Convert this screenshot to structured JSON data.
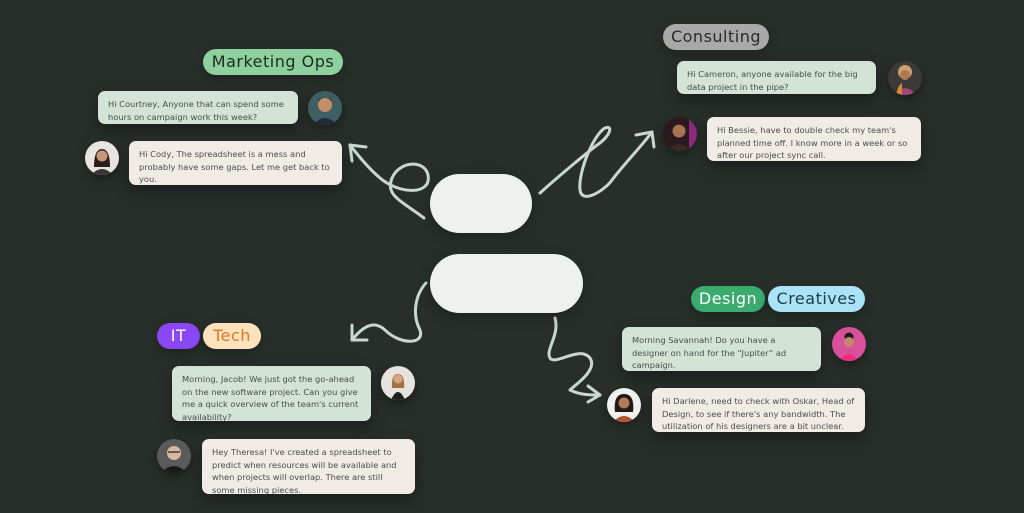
{
  "colors": {
    "background": "#282e2a",
    "arrow": "#c9d8cc",
    "marketing_tag": "#8fd19e",
    "consulting_tag": "#a9a9a9",
    "it_tag": "#8a48f5",
    "tech_tag": "#fde2bd",
    "design_tag": "#3aaa6e",
    "creatives_tag": "#a9e3f5"
  },
  "center_nodes": [
    {
      "id": "node-1",
      "label": ""
    },
    {
      "id": "node-2",
      "label": ""
    }
  ],
  "groups": {
    "marketing": {
      "tags": [
        "Marketing Ops"
      ],
      "messages": [
        {
          "text": "Hi Courtney, Anyone that can spend some hours on campaign work this week?",
          "avatar": "man-avatar"
        },
        {
          "text": "Hi Cody, The spreadsheet is a mess and probably have some gaps.  Let me get back to you.",
          "avatar": "woman-avatar"
        }
      ]
    },
    "consulting": {
      "tags": [
        "Consulting"
      ],
      "messages": [
        {
          "text": "Hi Cameron, anyone available for the big data project in the pipe?",
          "avatar": "person-avatar"
        },
        {
          "text": "Hi Bessie, have to double check my team's planned time off. I know more in a week or so after our project sync call.",
          "avatar": "man-avatar"
        }
      ]
    },
    "it": {
      "tags": [
        "IT",
        "Tech"
      ],
      "messages": [
        {
          "text": "Morning, Jacob! We just got the go-ahead on the new software project. Can you give me a quick overview of the team's current availability?",
          "avatar": "woman-avatar"
        },
        {
          "text": "Hey Theresa! I've created a spreadsheet to predict when resources will be available and when projects will overlap. There are still some missing pieces.",
          "avatar": "man-avatar"
        }
      ]
    },
    "design": {
      "tags": [
        "Design",
        "Creatives"
      ],
      "messages": [
        {
          "text": "Morning Savannah! Do you have a designer on hand for the “Jupiter” ad campaign.",
          "avatar": "woman-avatar"
        },
        {
          "text": "Hi Darlene, need to check with Oskar, Head of Design, to see if there's any bandwidth. The utilization of his designers are a bit unclear.",
          "avatar": "woman-avatar"
        }
      ]
    }
  }
}
